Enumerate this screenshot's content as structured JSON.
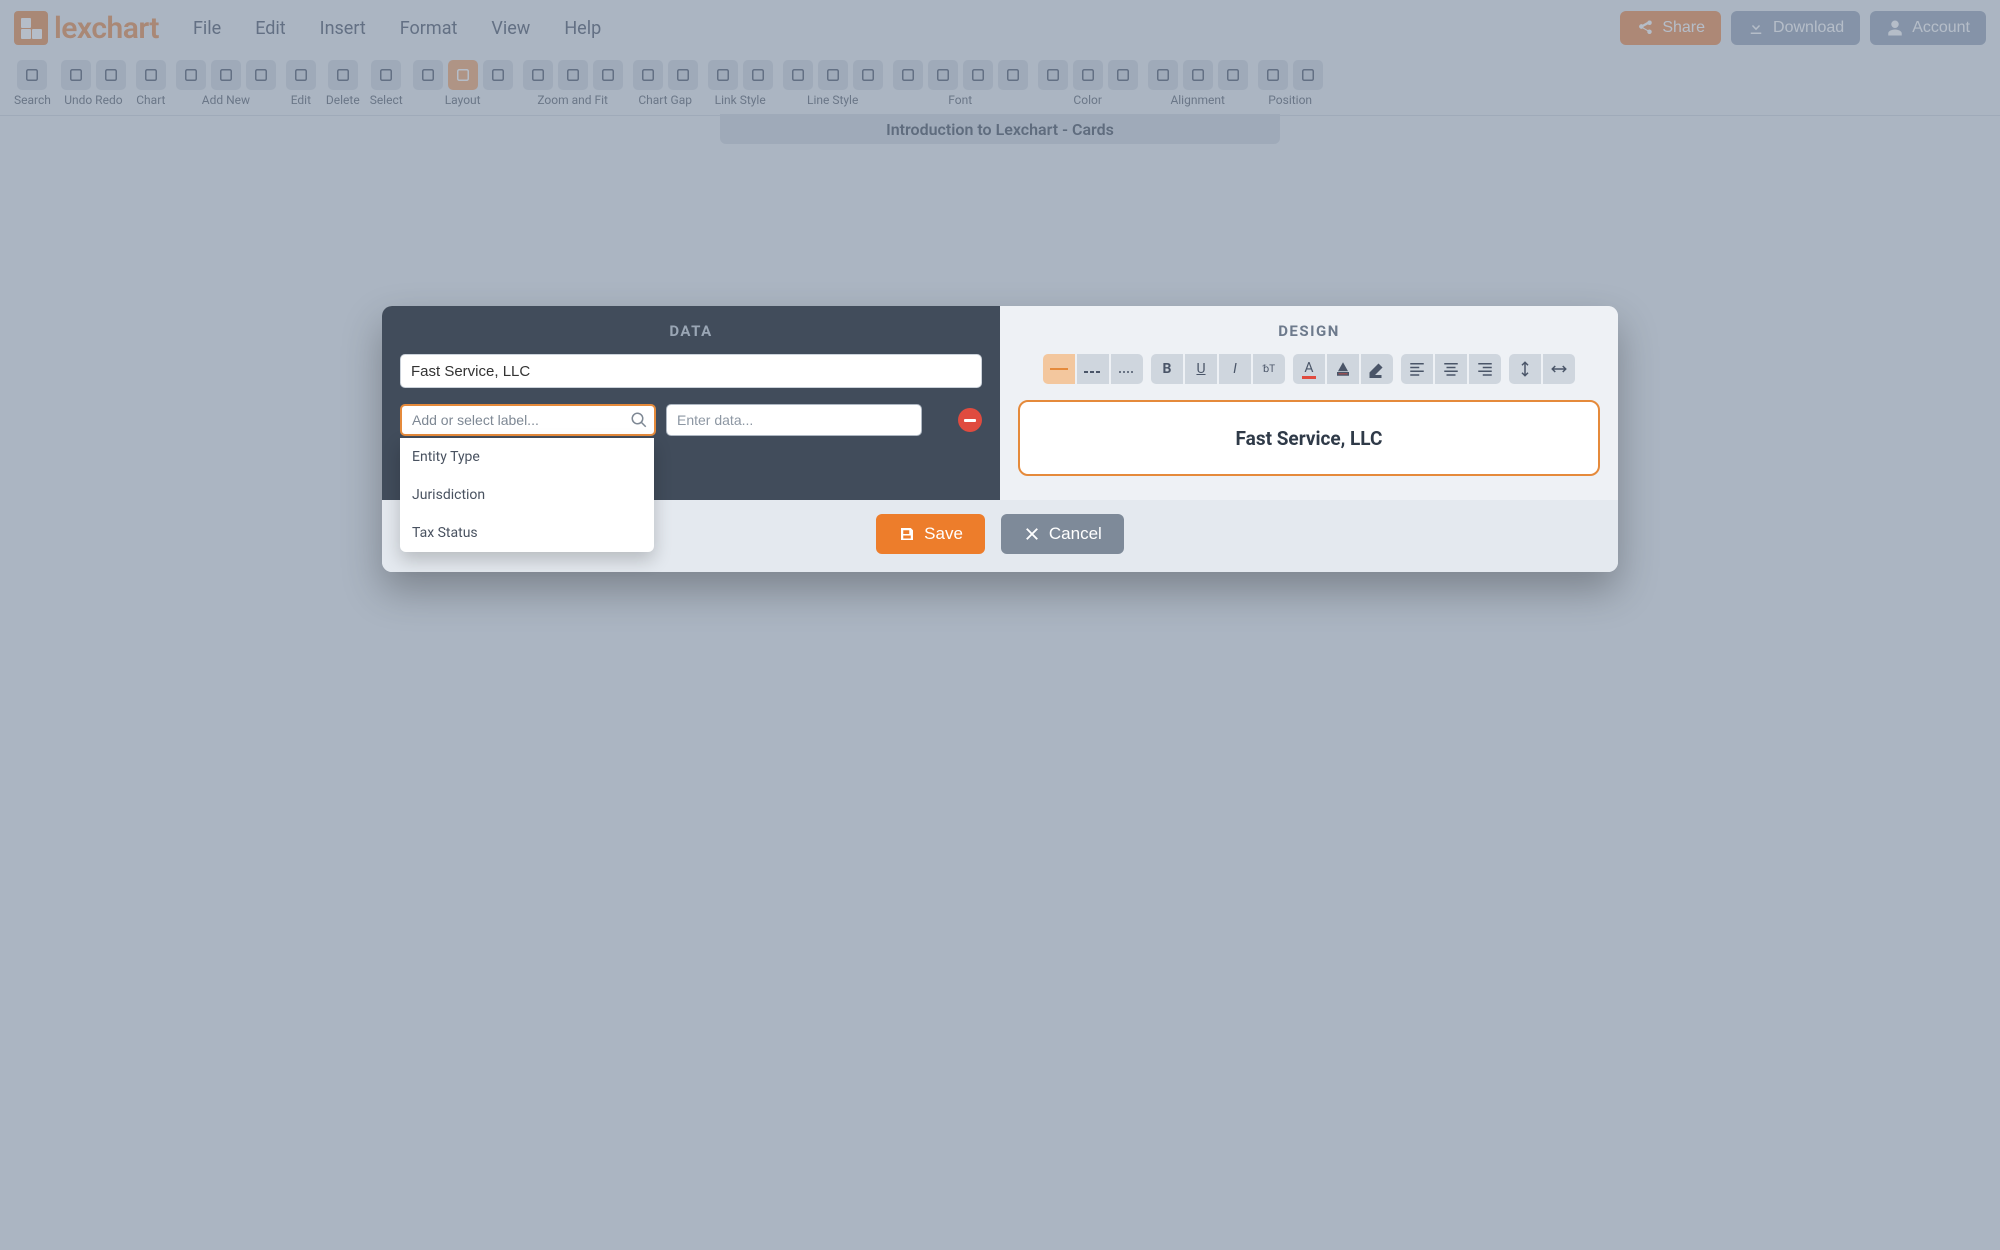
{
  "app": {
    "name": "lexchart"
  },
  "menubar": [
    "File",
    "Edit",
    "Insert",
    "Format",
    "View",
    "Help"
  ],
  "topButtons": {
    "share": "Share",
    "download": "Download",
    "account": "Account"
  },
  "toolbar": {
    "groups": [
      {
        "label": "Search",
        "count": 1
      },
      {
        "label": "Undo Redo",
        "count": 2
      },
      {
        "label": "Chart",
        "count": 1
      },
      {
        "label": "Add New",
        "count": 3
      },
      {
        "label": "Edit",
        "count": 1
      },
      {
        "label": "Delete",
        "count": 1
      },
      {
        "label": "Select",
        "count": 1
      },
      {
        "label": "Layout",
        "count": 3
      },
      {
        "label": "Zoom and Fit",
        "count": 3
      },
      {
        "label": "Chart Gap",
        "count": 2
      },
      {
        "label": "Link Style",
        "count": 2
      },
      {
        "label": "Line Style",
        "count": 3
      },
      {
        "label": "Font",
        "count": 4
      },
      {
        "label": "Color",
        "count": 3
      },
      {
        "label": "Alignment",
        "count": 3
      },
      {
        "label": "Position",
        "count": 2
      }
    ],
    "activeGroup": "Layout",
    "activeIndex": 1
  },
  "document": {
    "title": "Introduction to Lexchart - Cards"
  },
  "modal": {
    "tabs": {
      "data": "DATA",
      "design": "DESIGN"
    },
    "name_value": "Fast Service, LLC",
    "label_placeholder": "Add or select label...",
    "data_placeholder": "Enter data...",
    "dropdown": [
      "Entity Type",
      "Jurisdiction",
      "Tax Status"
    ],
    "preview_name": "Fast Service, LLC",
    "buttons": {
      "save": "Save",
      "cancel": "Cancel"
    }
  }
}
